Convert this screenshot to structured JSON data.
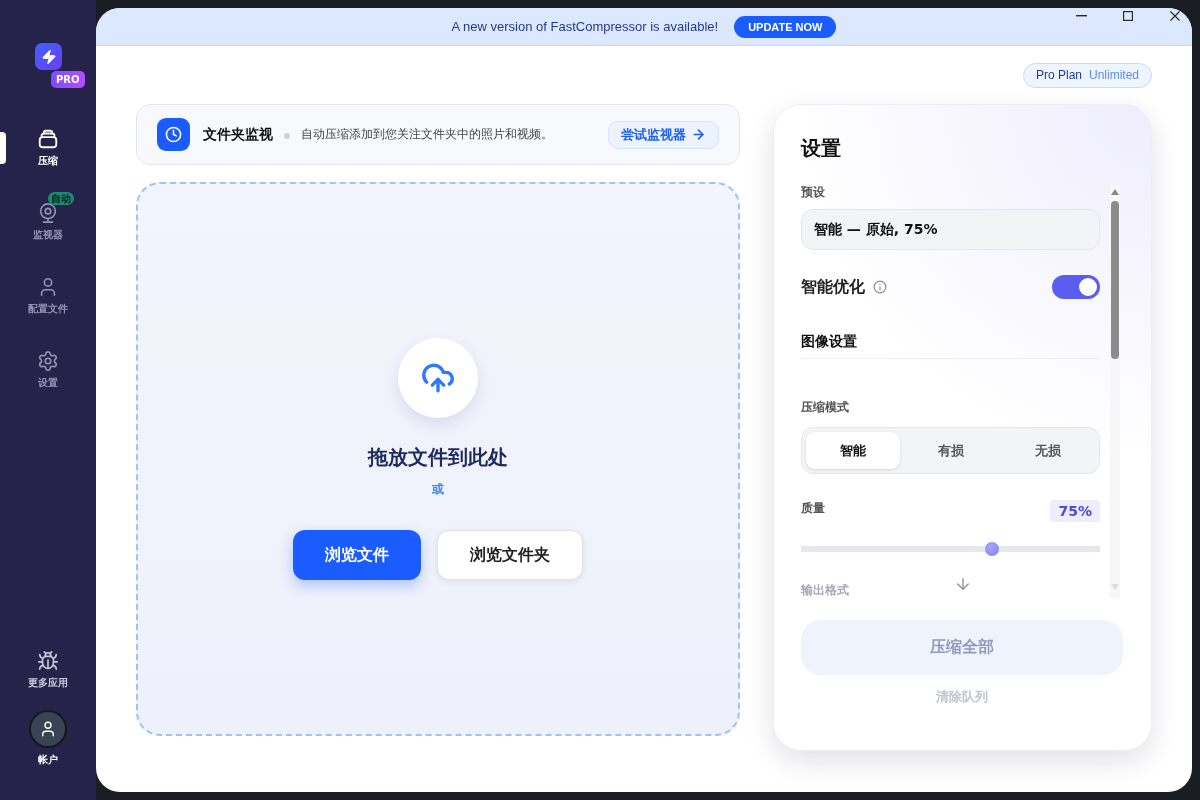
{
  "sidebar": {
    "logo_badge": "PRO",
    "nav_items": [
      {
        "label": "压缩",
        "selected": true
      },
      {
        "label": "监视器",
        "selected": false,
        "badge": "自动"
      },
      {
        "label": "配置文件",
        "selected": false
      },
      {
        "label": "设置",
        "selected": false
      }
    ],
    "bottom_items": [
      {
        "kind": "apps",
        "label": "更多应用"
      },
      {
        "kind": "account",
        "label": "帐户"
      }
    ]
  },
  "banner": {
    "message": "A new version of FastCompressor is available!",
    "button": "UPDATE NOW"
  },
  "plan": {
    "name": "Pro Plan",
    "tier": "Unlimited"
  },
  "folder_monitor": {
    "title": "文件夹监视",
    "description": "自动压缩添加到您关注文件夹中的照片和视频。",
    "button": "尝试监视器"
  },
  "drop_zone": {
    "heading": "拖放文件到此处",
    "separator": "或",
    "buttons": [
      {
        "kind": "primary",
        "label": "浏览文件"
      },
      {
        "kind": "secondary",
        "label": "浏览文件夹"
      }
    ]
  },
  "settings": {
    "title": "设置",
    "preset": {
      "label": "预设",
      "value": "智能 — 原始, 75%"
    },
    "smart_optimize": {
      "label": "智能优化",
      "on": true
    },
    "image_section": {
      "title": "图像设置"
    },
    "mode": {
      "label": "压缩模式",
      "options": [
        {
          "label": "智能",
          "selected": true
        },
        {
          "label": "有损",
          "selected": false
        },
        {
          "label": "无损",
          "selected": false
        }
      ]
    },
    "quality": {
      "label": "质量",
      "reading": "75%",
      "level": 0.64
    },
    "output_format": {
      "label": "输出格式"
    },
    "compress_button": {
      "label": "压缩全部",
      "disabled": true
    },
    "clear_button": {
      "label": "清除队列",
      "disabled": true
    }
  }
}
